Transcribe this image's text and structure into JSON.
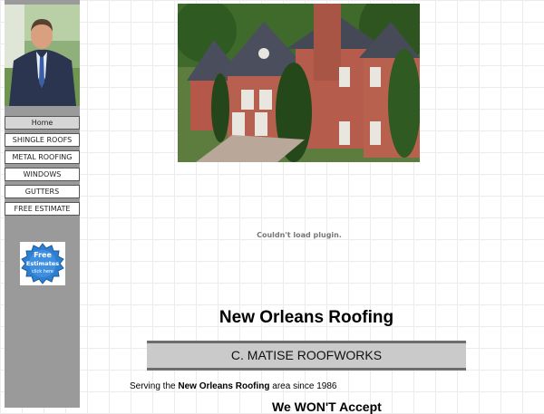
{
  "sidebar": {
    "nav": [
      {
        "label": "Home"
      },
      {
        "label": "SHINGLE ROOFS"
      },
      {
        "label": "METAL ROOFING"
      },
      {
        "label": "WINDOWS"
      },
      {
        "label": "GUTTERS"
      },
      {
        "label": "FREE ESTIMATE"
      }
    ],
    "badge": {
      "line1": "Free",
      "line2": "Estimates",
      "line3": "click here"
    }
  },
  "main": {
    "plugin_message": "Couldn't load plugin.",
    "title": "New Orleans Roofing",
    "banner": "C. MATISE ROOFWORKS",
    "serving": {
      "prefix": "Serving the ",
      "bold": "New Orleans Roofing",
      "suffix": " area since 1986"
    },
    "partial_heading": "We WON'T Accept"
  },
  "colors": {
    "sidebar_bg": "#9a9a9a",
    "banner_bg": "#cacaca",
    "banner_rule": "#6d6d6d"
  }
}
